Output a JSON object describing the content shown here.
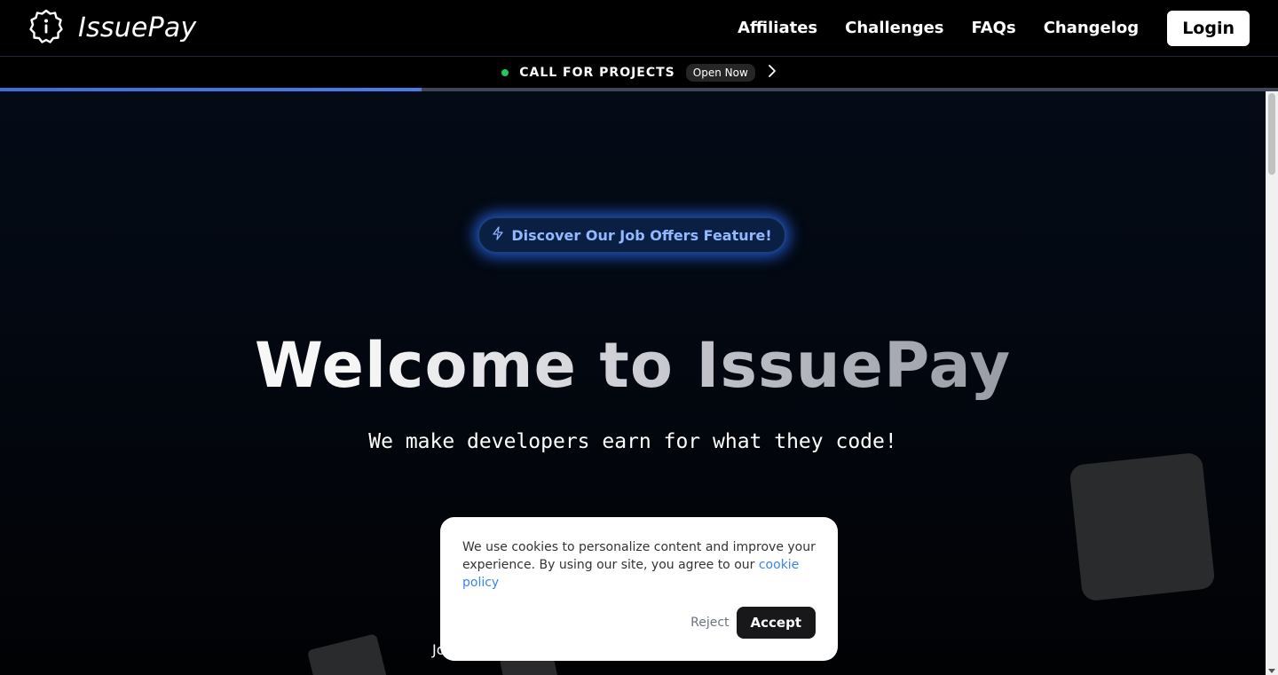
{
  "brand": {
    "name": "IssuePay",
    "logo_icon": "info-badge-icon"
  },
  "nav": {
    "links": [
      "Affiliates",
      "Challenges",
      "FAQs",
      "Changelog"
    ],
    "login_label": "Login"
  },
  "announcement": {
    "text": "CALL FOR PROJECTS",
    "badge": "Open Now",
    "status_color": "#22c55e",
    "progress": 0.33
  },
  "hero": {
    "feature_button": "Discover Our Job Offers Feature!",
    "feature_icon": "lightning-icon",
    "title": "Welcome to IssuePay",
    "subtitle": "We make developers earn for what they code!",
    "partial_text": "Jo"
  },
  "cookie": {
    "text": "We use cookies to personalize content and improve your experience. By using our site, you agree to our ",
    "link_label": "cookie policy",
    "reject_label": "Reject",
    "accept_label": "Accept"
  },
  "colors": {
    "accent": "#3b82f6",
    "glow": "#286eff",
    "background": "#000000"
  }
}
